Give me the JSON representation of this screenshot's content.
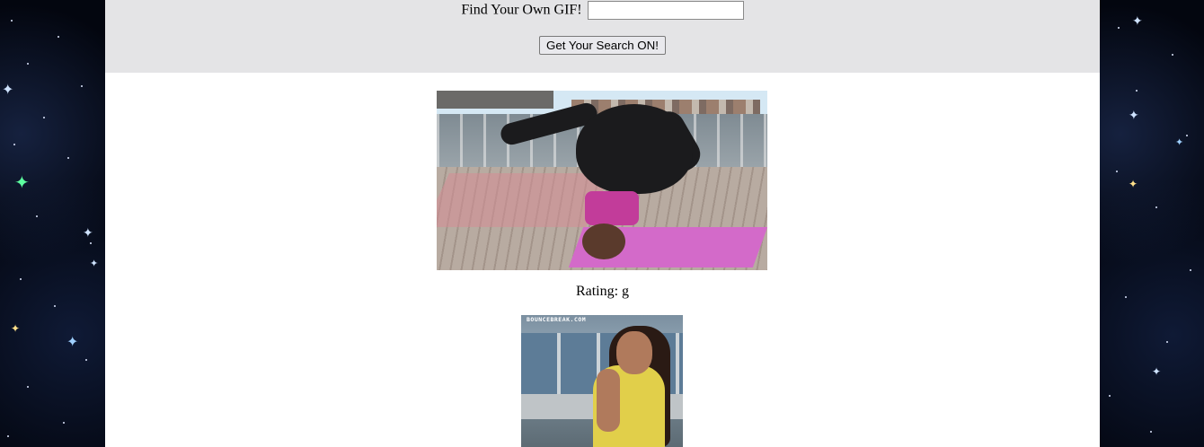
{
  "search": {
    "label": "Find Your Own GIF!",
    "input_value": "",
    "input_placeholder": "",
    "button_label": "Get Your Search ON!"
  },
  "results": [
    {
      "image": "gif-yoga-headstand",
      "rating_label": "Rating: g"
    },
    {
      "image": "gif-woman-yellow-top",
      "watermark": "BOUNCEBREAK.COM"
    }
  ],
  "background": {
    "theme": "starry-space",
    "header_color": "#e4e4e6",
    "content_color": "#ffffff"
  }
}
